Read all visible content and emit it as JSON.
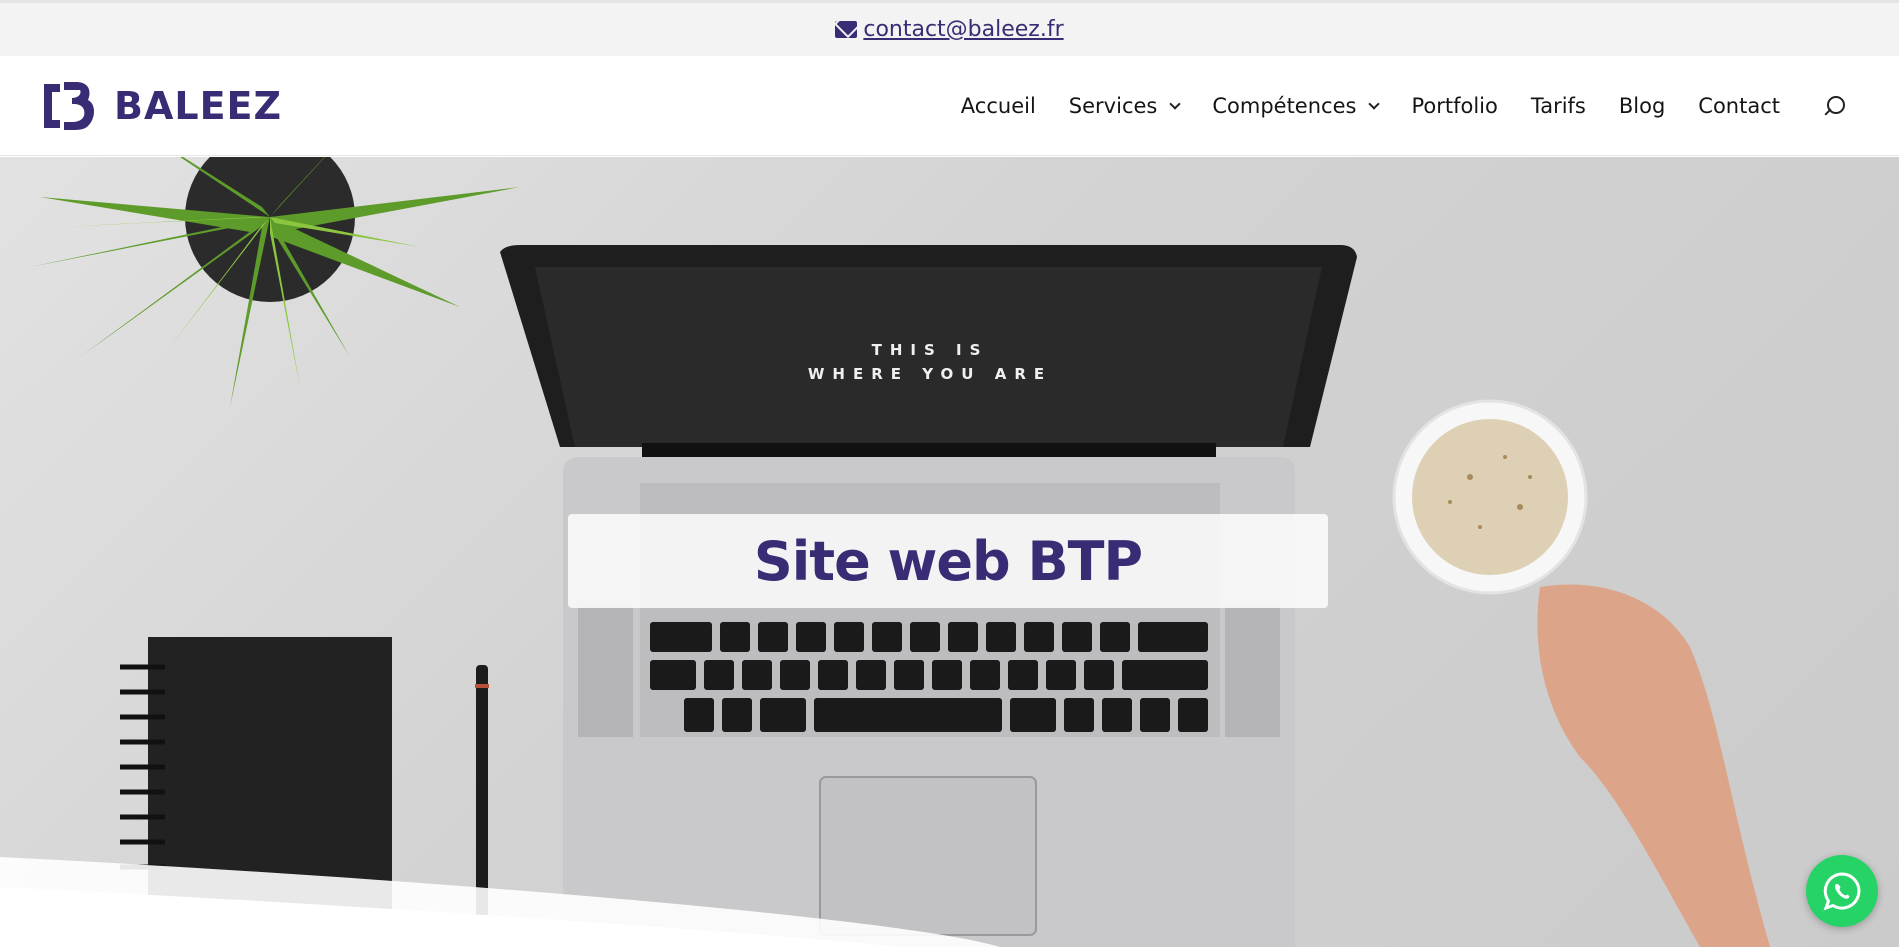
{
  "topbar": {
    "email": "contact@baleez.fr",
    "icon": "envelope-icon"
  },
  "header": {
    "logo_text": "BALEEZ",
    "nav": [
      {
        "label": "Accueil",
        "dropdown": false
      },
      {
        "label": "Services",
        "dropdown": true
      },
      {
        "label": "Compétences",
        "dropdown": true
      },
      {
        "label": "Portfolio",
        "dropdown": false
      },
      {
        "label": "Tarifs",
        "dropdown": false
      },
      {
        "label": "Blog",
        "dropdown": false
      },
      {
        "label": "Contact",
        "dropdown": false
      }
    ],
    "search_icon": "search-icon"
  },
  "hero": {
    "title": "Site web BTP",
    "screen_text_line1": "THIS IS",
    "screen_text_line2": "WHERE YOU ARE"
  },
  "floating": {
    "icon": "whatsapp-icon"
  },
  "colors": {
    "brand": "#3a2c74",
    "whatsapp": "#25d366"
  }
}
